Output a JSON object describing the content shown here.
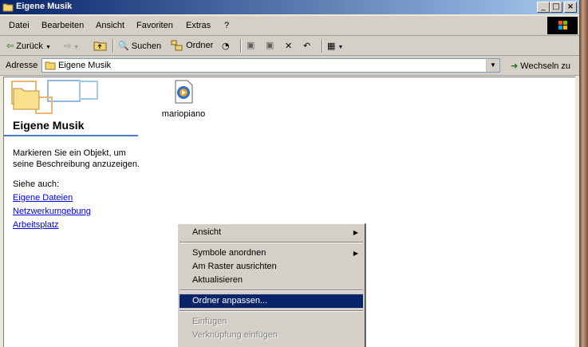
{
  "window": {
    "title": "Eigene Musik"
  },
  "menubar": {
    "items": [
      "Datei",
      "Bearbeiten",
      "Ansicht",
      "Favoriten",
      "Extras",
      "?"
    ]
  },
  "toolbar": {
    "back": "Zurück",
    "search": "Suchen",
    "folders": "Ordner"
  },
  "address": {
    "label": "Adresse",
    "value": "Eigene Musik",
    "go": "Wechseln zu"
  },
  "panel": {
    "title": "Eigene Musik",
    "description": "Markieren Sie ein Objekt, um seine Beschreibung anzuzeigen.",
    "see_also": "Siehe auch:",
    "links": [
      "Eigene Dateien",
      "Netzwerkumgebung",
      "Arbeitsplatz"
    ]
  },
  "files": [
    {
      "name": "mariopiano",
      "icon": "media-file-icon"
    }
  ],
  "context_menu": {
    "items": [
      {
        "label": "Ansicht",
        "submenu": true,
        "state": "normal"
      },
      {
        "label": "Symbole anordnen",
        "submenu": true,
        "state": "normal"
      },
      {
        "label": "Am Raster ausrichten",
        "submenu": false,
        "state": "normal"
      },
      {
        "label": "Aktualisieren",
        "submenu": false,
        "state": "normal"
      },
      {
        "label": "Ordner anpassen...",
        "submenu": false,
        "state": "selected"
      },
      {
        "label": "Einfügen",
        "submenu": false,
        "state": "disabled"
      },
      {
        "label": "Verknüpfung einfügen",
        "submenu": false,
        "state": "disabled"
      }
    ]
  },
  "colors": {
    "titlebar": "#0a246a",
    "selection": "#0a246a",
    "link": "#0000ee",
    "panel_accent": "#4a7ec8"
  }
}
